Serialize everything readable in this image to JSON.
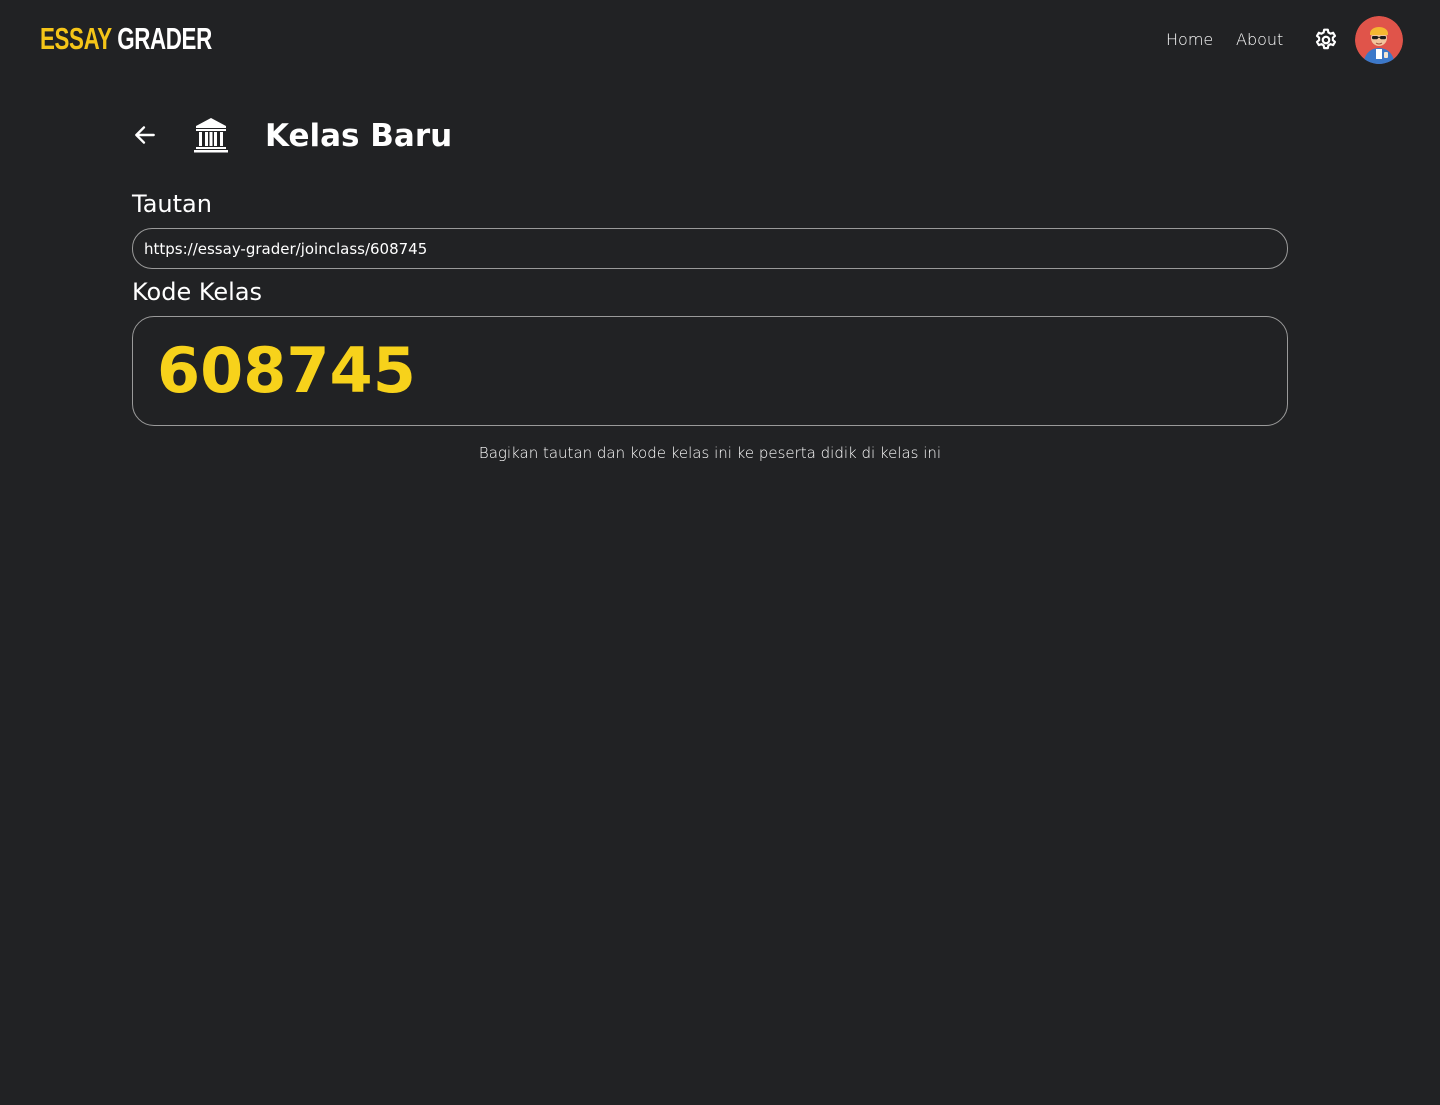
{
  "navbar": {
    "logo_part1": "ESSAY",
    "logo_part2": "GRADER",
    "links": [
      {
        "label": "Home"
      },
      {
        "label": "About"
      }
    ],
    "settings_icon": "gear-icon",
    "avatar_icon": "user-avatar"
  },
  "header": {
    "back_icon": "arrow-left-icon",
    "class_icon": "bank-building-icon",
    "title": "Kelas Baru"
  },
  "link_section": {
    "label": "Tautan",
    "value": "https://essay-grader/joinclass/608745"
  },
  "code_section": {
    "label": "Kode Kelas",
    "code": "608745"
  },
  "hint": "Bagikan tautan dan kode kelas ini ke peserta didik di kelas ini",
  "colors": {
    "background": "#212224",
    "accent": "#f7d21b",
    "text": "#ffffff",
    "border": "#9a9a9a"
  }
}
